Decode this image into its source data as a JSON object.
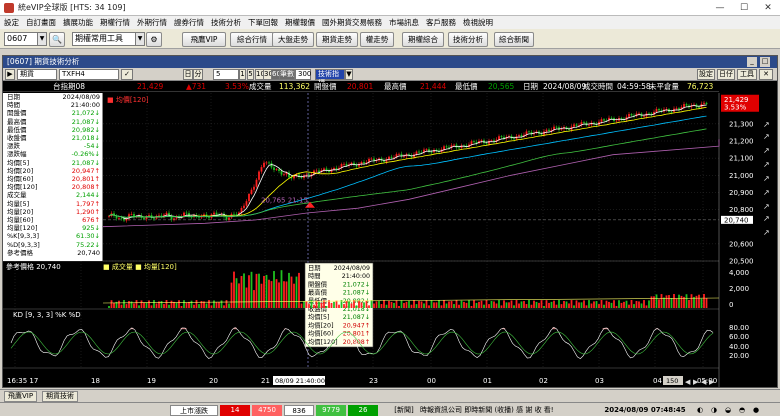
{
  "window_title": "統eVIP全球版 [HTS: 34 109]",
  "menu": [
    "設定",
    "自訂畫面",
    "擴展功能",
    "期權行情",
    "外期行情",
    "證券行情",
    "技術分析",
    "下單回報",
    "期權報價",
    "國外期貨交易帳務",
    "市場訊息",
    "客戶服務",
    "檢視說明"
  ],
  "toolbar": {
    "code_value": "0607",
    "tool_select": "期權常用工具",
    "buttons": [
      "飛鷹VIP",
      "綜合行情",
      "大盤走勢",
      "期貨走勢",
      "權走勢",
      "期權綜合",
      "技術分析",
      "綜合新聞"
    ]
  },
  "chart_window": {
    "title": "[0607] 期貨技術分析",
    "right_buttons": [
      "設定",
      "日仔",
      "工具"
    ],
    "controls": {
      "instrument_type": "期貨",
      "symbol": "TXFH4",
      "period_label": "日",
      "period_unit": "分",
      "period_value": "5",
      "intervals": [
        "1",
        "5",
        "10",
        "30",
        "60"
      ],
      "count_label": "筆數",
      "count_value": "300",
      "mode_select": "技術指標"
    },
    "info_row": {
      "name": "台指期08",
      "price": "21,429",
      "change": "▲731",
      "change_pct": "3.53%",
      "volume_label": "成交量",
      "volume": "113,362",
      "open_label": "開盤價",
      "open": "20,801",
      "high_label": "最高價",
      "high": "21,444",
      "low_label": "最低價",
      "low": "20,565",
      "date_label": "日期",
      "date": "2024/08/09",
      "time_label": "成交時間",
      "time": "04:59:58",
      "oi_label": "未平倉量",
      "oi": "76,723"
    },
    "panel": [
      {
        "label": "日期",
        "value": "2024/08/09",
        "cls": "bl"
      },
      {
        "label": "時間",
        "value": "21:40:00",
        "cls": "bl"
      },
      {
        "label": "開盤價",
        "value": "21,072↓",
        "cls": "dn"
      },
      {
        "label": "最高價",
        "value": "21,087↓",
        "cls": "dn"
      },
      {
        "label": "最低價",
        "value": "20,982↓",
        "cls": "dn"
      },
      {
        "label": "收盤價",
        "value": "21,018↓",
        "cls": "dn"
      },
      {
        "label": "漲跌",
        "value": "-54↓",
        "cls": "dn"
      },
      {
        "label": "漲跌幅",
        "value": "-0.26%↓",
        "cls": "dn"
      },
      {
        "label": "均價[5]",
        "value": "21,087↓",
        "cls": "dn"
      },
      {
        "label": "均價[20]",
        "value": "20,947↑",
        "cls": "up"
      },
      {
        "label": "均價[60]",
        "value": "20,801↑",
        "cls": "up"
      },
      {
        "label": "均價[120]",
        "value": "20,808↑",
        "cls": "up"
      },
      {
        "label": "成交量",
        "value": "2,144↓",
        "cls": "dn"
      },
      {
        "label": "均量[5]",
        "value": "1,797↑",
        "cls": "up"
      },
      {
        "label": "均量[20]",
        "value": "1,290↑",
        "cls": "up"
      },
      {
        "label": "均量[60]",
        "value": "676↑",
        "cls": "up"
      },
      {
        "label": "均量[120]",
        "value": "925↓",
        "cls": "dn"
      },
      {
        "label": "%K[9,3,3]",
        "value": "61.30↓",
        "cls": "dn"
      },
      {
        "label": "%D[9,3,3]",
        "value": "75.22↓",
        "cls": "dn"
      },
      {
        "label": "參考價格",
        "value": "20,740",
        "cls": "bl"
      }
    ],
    "price_legend": "均價[120]",
    "volume_legend": "成交量",
    "volume_legend2": "均量[120]",
    "kd_legend": "KD [9, 3, 3] %K %D",
    "price_axis": [
      "21,429",
      "21,300",
      "21,200",
      "21,100",
      "21,000",
      "20,900",
      "20,800",
      "20,740",
      "20,600",
      "20,500"
    ],
    "price_tag_pct": "3.53%",
    "volume_axis": [
      "4,000",
      "2,000",
      "0"
    ],
    "kd_axis": [
      "80.00",
      "60.00",
      "40.00",
      "20.00"
    ],
    "x_labels": [
      "16:35 17",
      "18",
      "19",
      "20",
      "21",
      "08/09 21:40:00",
      "23",
      "00",
      "01",
      "02",
      "03",
      "04",
      "05:00"
    ],
    "annotation": "20,765 21:15",
    "cursor_zoom": "150",
    "tooltip": [
      [
        "日期",
        "2024/08/09"
      ],
      [
        "時間",
        "21:40:00"
      ],
      [
        "開盤價",
        "21,072↓"
      ],
      [
        "最高價",
        "21,087↓"
      ],
      [
        "最低價",
        "20,982↓"
      ],
      [
        "收盤價",
        "21,018↓"
      ],
      [
        "均價[5]",
        "21,087↓"
      ],
      [
        "均價[20]",
        "20,947↑"
      ],
      [
        "均價[60]",
        "20,801↑"
      ],
      [
        "均價[120]",
        "20,808↑"
      ]
    ]
  },
  "status": {
    "tabs": [
      "飛鷹VIP",
      "期貨技術"
    ],
    "market_label": "上市漲跌",
    "market_values": [
      "14",
      "4750",
      "836",
      "9779",
      "26"
    ],
    "news_label": "[新聞]",
    "news_text": "時報資訊公司 即時新聞 (收播)  感 謝 收 看!",
    "clock": "2024/08/09 07:48:45"
  },
  "chart_data": {
    "type": "line",
    "x": [
      "17",
      "18",
      "19",
      "20",
      "21",
      "22",
      "23",
      "00",
      "01",
      "02",
      "03",
      "04",
      "05"
    ],
    "series": [
      {
        "name": "收盤價",
        "values": [
          20760,
          20780,
          20790,
          20820,
          21060,
          21080,
          21250,
          21320,
          21300,
          21300,
          21360,
          21380,
          21429
        ]
      },
      {
        "name": "均價[120]",
        "values": [
          20700,
          20710,
          20720,
          20740,
          20780,
          20808,
          20860,
          20930,
          21000,
          21060,
          21120,
          21170,
          21210
        ]
      }
    ],
    "ylim": [
      20500,
      21480
    ]
  }
}
